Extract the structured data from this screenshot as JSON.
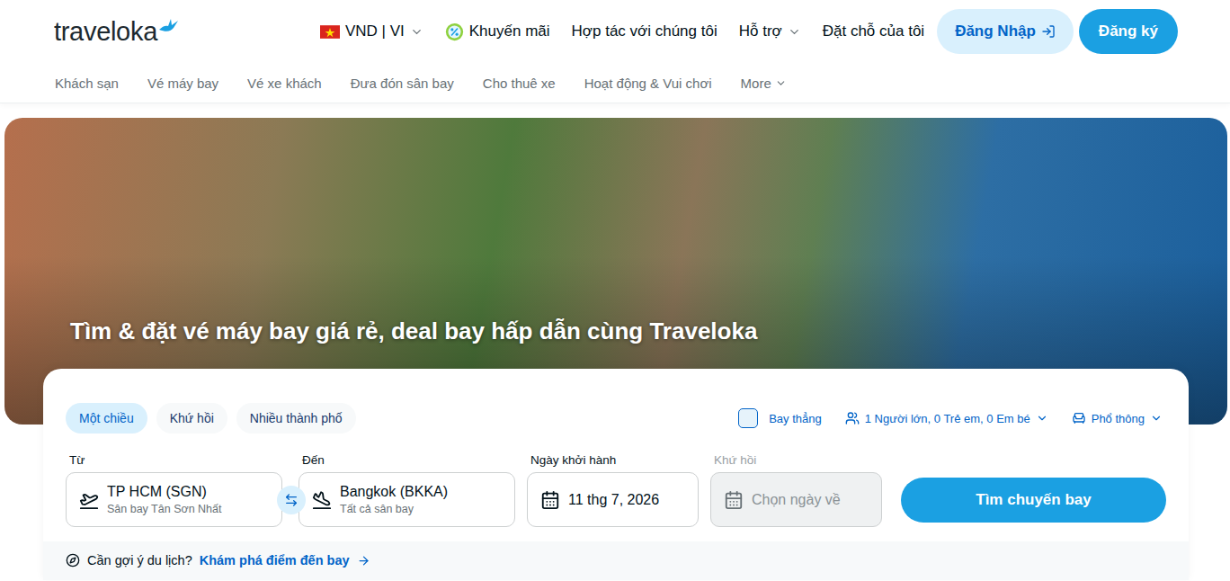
{
  "logo": {
    "text": "traveloka"
  },
  "header": {
    "links": [
      {
        "label": "VND | VI",
        "kind": "locale"
      },
      {
        "label": "Khuyến mãi",
        "kind": "promo"
      },
      {
        "label": "Hợp tác với chúng tôi",
        "kind": "plain"
      },
      {
        "label": "Hỗ trợ",
        "kind": "dropdown"
      },
      {
        "label": "Đặt chỗ của tôi",
        "kind": "plain"
      }
    ],
    "login": "Đăng Nhập",
    "register": "Đăng ký"
  },
  "categories": [
    {
      "label": "Khách sạn",
      "selected": false,
      "dropdown": false
    },
    {
      "label": "Vé máy bay",
      "selected": false,
      "dropdown": false
    },
    {
      "label": "Vé xe khách",
      "selected": false,
      "dropdown": false
    },
    {
      "label": "Đưa đón sân bay",
      "selected": false,
      "dropdown": false
    },
    {
      "label": "Cho thuê xe",
      "selected": false,
      "dropdown": false
    },
    {
      "label": "Hoạt động & Vui chơi",
      "selected": false,
      "dropdown": false
    },
    {
      "label": "More",
      "selected": false,
      "dropdown": true
    }
  ],
  "hero": {
    "headline": "Tìm & đặt vé máy bay giá rẻ, deal bay hấp dẫn cùng Traveloka"
  },
  "search": {
    "trip_types": [
      {
        "label": "Một chiều",
        "selected": true
      },
      {
        "label": "Khứ hồi",
        "selected": false
      },
      {
        "label": "Nhiều thành phố",
        "selected": false
      }
    ],
    "direct": {
      "label": "Bay thẳng",
      "checked": false
    },
    "passengers": "1 Người lớn, 0 Trẻ em, 0 Em bé",
    "cabin": "Phổ thông",
    "fields": [
      {
        "label": "Từ",
        "kind": "from",
        "value": "TP HCM (SGN)",
        "sub": "Sân bay Tân Sơn Nhất",
        "disabled": false
      },
      {
        "label": "Đến",
        "kind": "to",
        "value": "Bangkok (BKKA)",
        "sub": "Tất cả sân bay",
        "disabled": false
      },
      {
        "label": "Ngày khởi hành",
        "kind": "date",
        "value": "11 thg 7, 2026",
        "sub": "",
        "disabled": false
      },
      {
        "label": "Khứ hồi",
        "kind": "date",
        "value": "Chọn ngày về",
        "sub": "",
        "disabled": true
      }
    ],
    "button": "Tìm chuyến bay"
  },
  "suggest": {
    "prompt": "Cần gợi ý du lịch?",
    "link": "Khám phá điểm đến bay"
  }
}
